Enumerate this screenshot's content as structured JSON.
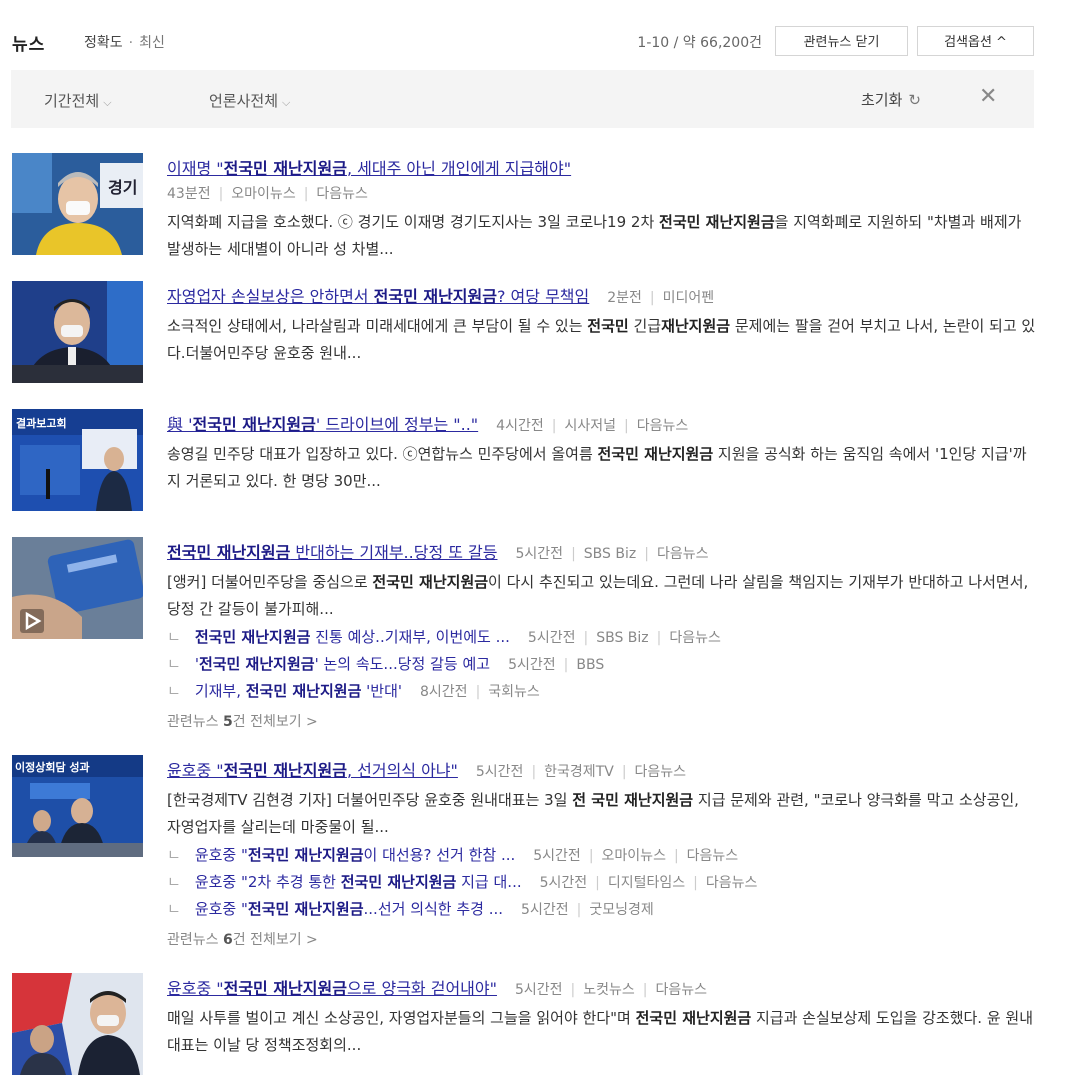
{
  "header": {
    "tab": "뉴스",
    "sort_accuracy": "정확도",
    "sort_dot": "·",
    "sort_latest": "최신",
    "count": "1-10 / 약 66,200건",
    "btn_related": "관련뉴스 닫기",
    "btn_options": "검색옵션 ^"
  },
  "filters": {
    "period": "기간전체",
    "press": "언론사전체",
    "reset": "초기화",
    "chevron": "⌵",
    "refresh": "↻",
    "close": "✕"
  },
  "items": [
    {
      "title": {
        "pre": "이재명 \"",
        "bold": "전국민 재난지원금",
        "post": ", 세대주 아닌 개인에게 지급해야\""
      },
      "meta": [
        "43분전",
        "오마이뉴스",
        "다음뉴스"
      ],
      "snippet": {
        "pre": "지역화폐 지급을 호소했다. ⓒ 경기도 이재명 경기도지사는 3일 코로나19 2차 ",
        "bold": "전국민 재난지원금",
        "post": "을 지역화폐로 지원하되 \"차별과 배제가 발생하는 세대별이 아니라 성 차별..."
      }
    },
    {
      "title": {
        "pre": "자영업자 손실보상은 안하면서 ",
        "bold": "전국민 재난지원금",
        "post": "? 여당 무책임"
      },
      "meta": [
        "2분전",
        "미디어펜"
      ],
      "snippet": {
        "pre": "소극적인 상태에서, 나라살림과 미래세대에게 큰 부담이 될 수 있는 ",
        "bold": "전국민",
        "mid": " 긴급",
        "bold2": "재난지원금",
        "post": " 문제에는 팔을 걷어 부치고 나서, 논란이 되고 있다.더불어민주당 윤호중 원내..."
      }
    },
    {
      "title": {
        "pre": "與 '",
        "bold": "전국민 재난지원금",
        "post": "' 드라이브에 정부는 \"..\""
      },
      "meta": [
        "4시간전",
        "시사저널",
        "다음뉴스"
      ],
      "snippet": {
        "pre": "송영길 민주당 대표가 입장하고 있다. ⓒ연합뉴스 민주당에서 올여름 ",
        "bold": "전국민 재난지원금",
        "post": " 지원을 공식화 하는 움직임 속에서 '1인당 지급'까지 거론되고 있다. 한 명당 30만..."
      }
    },
    {
      "title": {
        "pre": "",
        "bold": "전국민 재난지원금",
        "post": " 반대하는 기재부..당정 또 갈등"
      },
      "meta": [
        "5시간전",
        "SBS Biz",
        "다음뉴스"
      ],
      "snippet": {
        "pre": "[앵커] 더불어민주당을 중심으로 ",
        "bold": "전국민 재난지원금",
        "post": "이 다시 추진되고 있는데요. 그런데 나라 살림을 책임지는 기재부가 반대하고 나서면서, 당정 간 갈등이 불가피해..."
      },
      "subs": [
        {
          "pre": "",
          "bold": "전국민 재난지원금",
          "post": " 진통 예상..기재부, 이번에도 ...",
          "meta": [
            "5시간전",
            "SBS Biz",
            "다음뉴스"
          ]
        },
        {
          "pre": "'",
          "bold": "전국민 재난지원금",
          "post": "' 논의 속도...당정 갈등 예고",
          "meta": [
            "5시간전",
            "BBS"
          ]
        },
        {
          "pre": "기재부, ",
          "bold": "전국민 재난지원금",
          "post": " '반대'",
          "meta": [
            "8시간전",
            "국회뉴스"
          ]
        }
      ],
      "more": {
        "pre": "관련뉴스 ",
        "count": "5",
        "post": "건 전체보기 >"
      }
    },
    {
      "title": {
        "pre": "윤호중 \"",
        "bold": "전국민 재난지원금",
        "post": ", 선거의식 아냐\""
      },
      "meta": [
        "5시간전",
        "한국경제TV",
        "다음뉴스"
      ],
      "snippet": {
        "pre": "[한국경제TV 김현경 기자] 더불어민주당 윤호중 원내대표는 3일 ",
        "bold": "전 국민 재난지원금",
        "post": " 지급 문제와 관련, \"코로나 양극화를 막고 소상공인, 자영업자를 살리는데 마중물이 될..."
      },
      "subs": [
        {
          "pre": "윤호중 \"",
          "bold": "전국민 재난지원금",
          "post": "이 대선용? 선거 한참 ...",
          "meta": [
            "5시간전",
            "오마이뉴스",
            "다음뉴스"
          ]
        },
        {
          "pre": "윤호중 \"2차 추경 통한 ",
          "bold": "전국민 재난지원금",
          "post": " 지급 대...",
          "meta": [
            "5시간전",
            "디지털타임스",
            "다음뉴스"
          ]
        },
        {
          "pre": "윤호중 \"",
          "bold": "전국민 재난지원금",
          "post": "...선거 의식한 추경 ...",
          "meta": [
            "5시간전",
            "굿모닝경제"
          ]
        }
      ],
      "more": {
        "pre": "관련뉴스 ",
        "count": "6",
        "post": "건 전체보기 >"
      }
    },
    {
      "title": {
        "pre": "윤호중 \"",
        "bold": "전국민 재난지원금",
        "post": "으로 양극화 걷어내야\""
      },
      "meta": [
        "5시간전",
        "노컷뉴스",
        "다음뉴스"
      ],
      "snippet": {
        "pre": "매일 사투를 벌이고 계신 소상공인, 자영업자분들의 그늘을 읽어야 한다\"며 ",
        "bold": "전국민 재난지원금",
        "post": " 지급과 손실보상제 도입을 강조했다. 윤 원내대표는 이날 당 정책조정회의..."
      }
    }
  ],
  "thumb_labels": {
    "t1": "경기",
    "t3": "결과보고회",
    "t5": "이정상회담 성과"
  }
}
